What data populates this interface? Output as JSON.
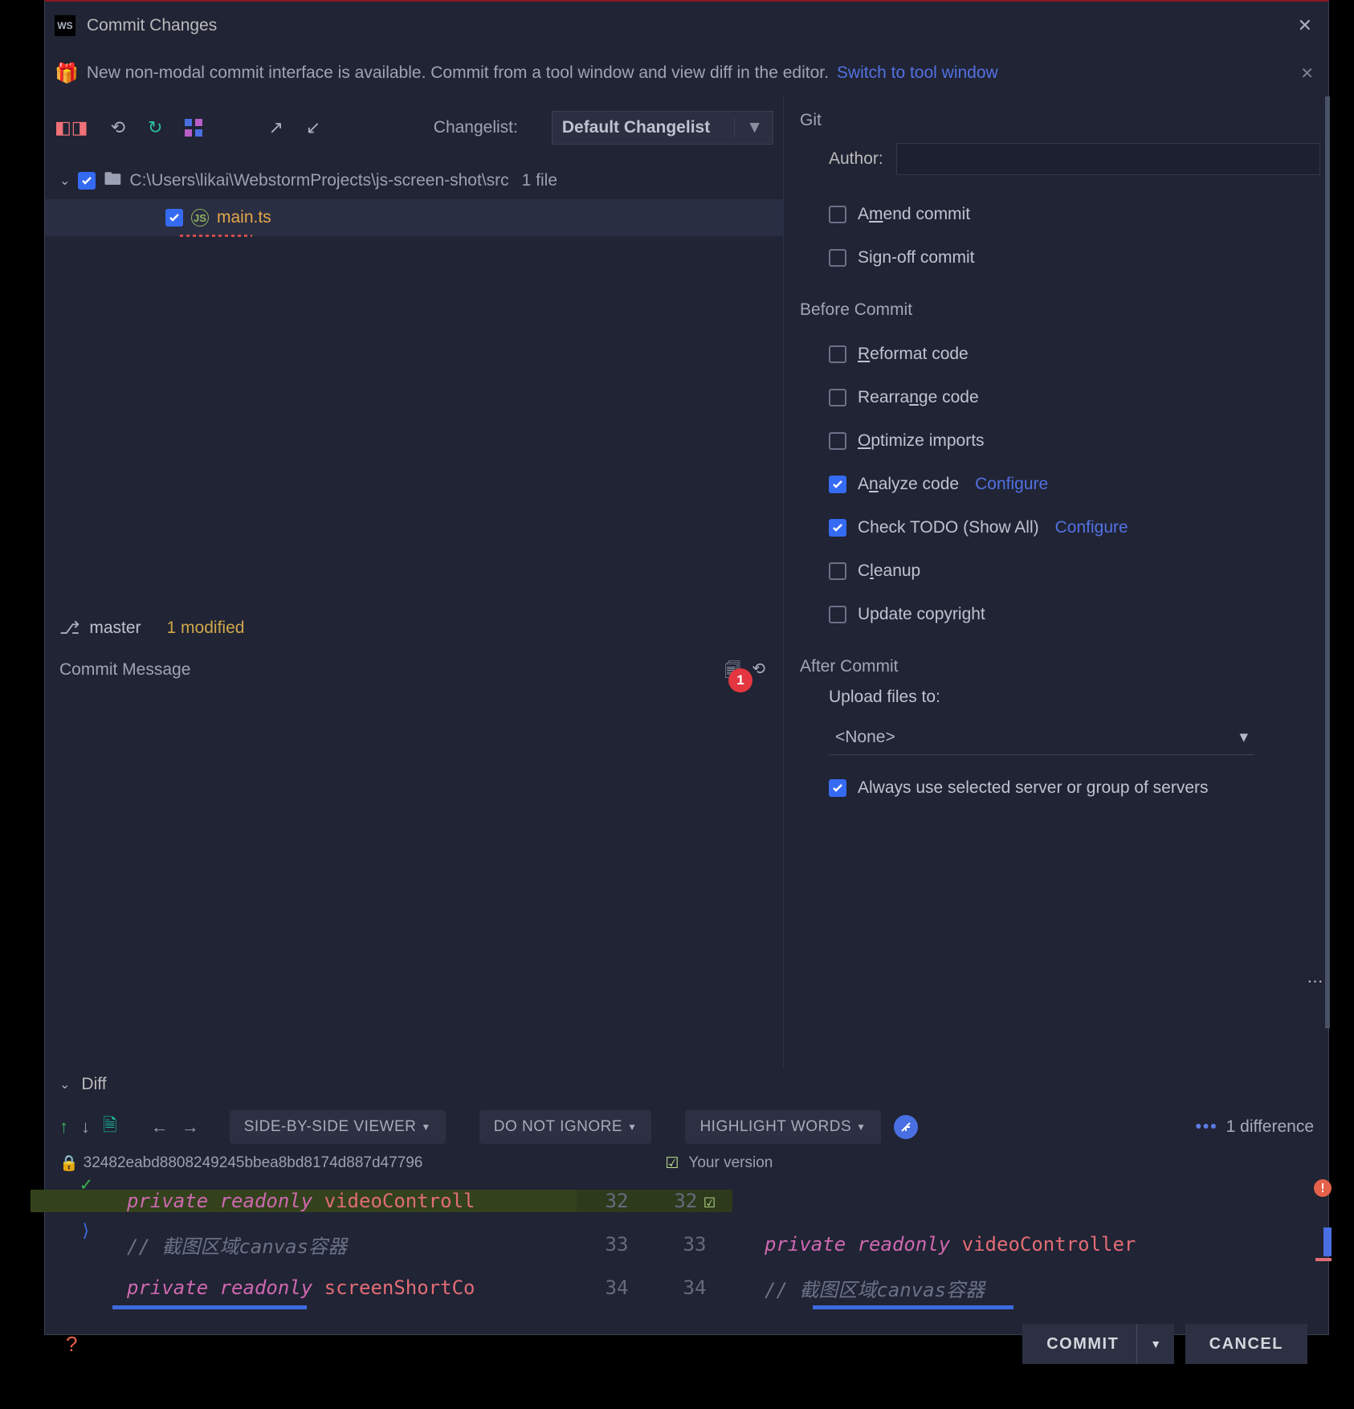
{
  "header": {
    "title": "Commit Changes"
  },
  "banner": {
    "text": "New non-modal commit interface is available. Commit from a tool window and view diff in the editor.",
    "link": "Switch to tool window"
  },
  "changelist": {
    "label": "Changelist:",
    "value": "Default Changelist"
  },
  "tree": {
    "path": "C:\\Users\\likai\\WebstormProjects\\js-screen-shot\\src",
    "count": "1 file",
    "file": "main.ts"
  },
  "branch": {
    "name": "master",
    "modified": "1 modified"
  },
  "message": {
    "label": "Commit Message",
    "badge": "1"
  },
  "right": {
    "git": "Git",
    "author": "Author:",
    "amend": "Amend commit",
    "signoff": "Sign-off commit",
    "before": "Before Commit",
    "reformat": "Reformat code",
    "rearrange": "Rearrange code",
    "optimize": "Optimize imports",
    "analyze": "Analyze code",
    "todo": "Check TODO (Show All)",
    "configure": "Configure",
    "cleanup": "Cleanup",
    "copyright": "Update copyright",
    "after": "After Commit",
    "upload_label": "Upload files to:",
    "upload_value": "<None>",
    "always": "Always use selected server or group of servers"
  },
  "diff": {
    "title": "Diff",
    "viewer": "SIDE-BY-SIDE VIEWER",
    "ignore": "DO NOT IGNORE",
    "highlight": "HIGHLIGHT WORDS",
    "count": "1 difference",
    "rev": "32482eabd8808249245bbea8bd8174d887d47796",
    "your_version": "Your version",
    "lines": {
      "l1_left": "private readonly videoControll",
      "l1_right": "",
      "l1_n": "32",
      "l2_cm": "// 截图区域canvas容器",
      "l2_n": "33",
      "l2_right_kw": "private readonly",
      "l2_right_var": "videoController",
      "l3_left": "private readonly screenShortCo",
      "l3_n": "34",
      "l3_right_cm": "// 截图区域canvas容器"
    }
  },
  "footer": {
    "commit": "COMMIT",
    "cancel": "CANCEL"
  }
}
